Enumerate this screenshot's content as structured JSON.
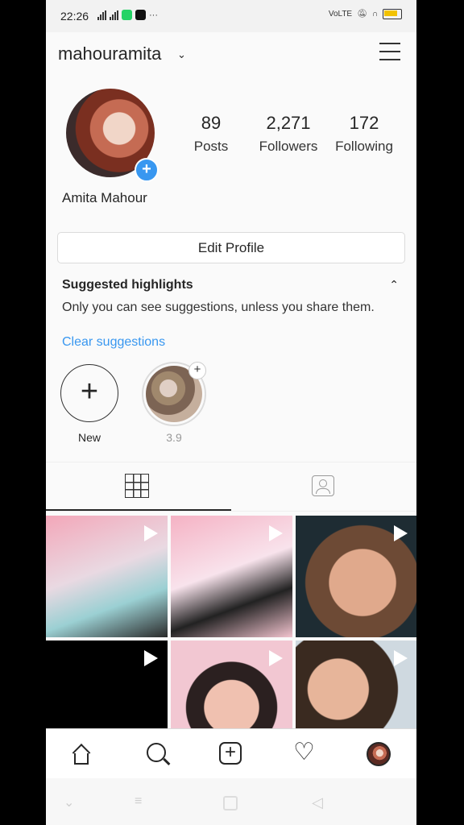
{
  "status_bar": {
    "time": "22:26",
    "left_extra": "···",
    "volte": "VoLTE"
  },
  "header": {
    "username": "mahouramita"
  },
  "profile": {
    "posts": {
      "count": "89",
      "label": "Posts"
    },
    "followers": {
      "count": "2,271",
      "label": "Followers"
    },
    "following": {
      "count": "172",
      "label": "Following"
    },
    "display_name": "Amita Mahour",
    "edit_profile_label": "Edit Profile"
  },
  "highlights": {
    "title": "Suggested highlights",
    "description": "Only you can see suggestions, unless you share them.",
    "clear_label": "Clear suggestions",
    "new_label": "New",
    "suggested_label": "3.9"
  },
  "colors": {
    "accent": "#3897f0",
    "text": "#262626",
    "background": "#fafafa"
  }
}
